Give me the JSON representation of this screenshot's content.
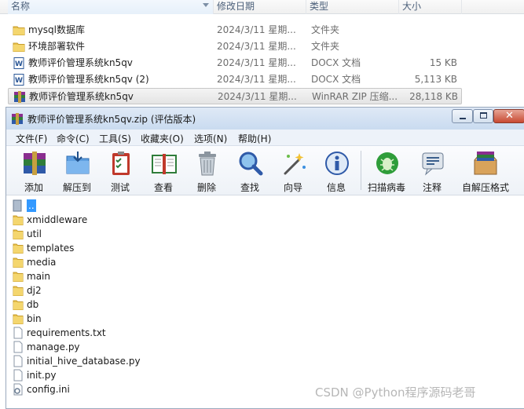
{
  "explorer": {
    "columns": {
      "name": "名称",
      "modified": "修改日期",
      "type": "类型",
      "size": "大小"
    },
    "rows": [
      {
        "name": "mysql数据库",
        "date": "2024/3/11 星期...",
        "type": "文件夹",
        "size": "",
        "icon": "folder-icon"
      },
      {
        "name": "环境部署软件",
        "date": "2024/3/11 星期...",
        "type": "文件夹",
        "size": "",
        "icon": "folder-icon"
      },
      {
        "name": "教师评价管理系统kn5qv",
        "date": "2024/3/11 星期...",
        "type": "DOCX 文档",
        "size": "15 KB",
        "icon": "word-doc-icon"
      },
      {
        "name": "教师评价管理系统kn5qv (2)",
        "date": "2024/3/11 星期...",
        "type": "DOCX 文档",
        "size": "5,113 KB",
        "icon": "word-doc-icon"
      },
      {
        "name": "教师评价管理系统kn5qv",
        "date": "2024/3/11 星期...",
        "type": "WinRAR ZIP 压缩...",
        "size": "28,118 KB",
        "icon": "winrar-archive-icon"
      }
    ]
  },
  "winrar": {
    "title": "教师评价管理系统kn5qv.zip (评估版本)",
    "menu": [
      "文件(F)",
      "命令(C)",
      "工具(S)",
      "收藏夹(O)",
      "选项(N)",
      "帮助(H)"
    ],
    "toolbar": [
      {
        "label": "添加",
        "icon": "add-books-icon"
      },
      {
        "label": "解压到",
        "icon": "extract-folder-icon"
      },
      {
        "label": "测试",
        "icon": "test-clipboard-icon"
      },
      {
        "label": "查看",
        "icon": "view-book-icon"
      },
      {
        "label": "删除",
        "icon": "delete-trash-icon"
      },
      {
        "label": "查找",
        "icon": "find-magnifier-icon"
      },
      {
        "label": "向导",
        "icon": "wizard-wand-icon"
      },
      {
        "label": "信息",
        "icon": "info-icon"
      },
      {
        "label": "扫描病毒",
        "icon": "virus-scan-icon"
      },
      {
        "label": "注释",
        "icon": "comment-icon"
      },
      {
        "label": "自解压格式",
        "icon": "sfx-box-icon"
      }
    ],
    "files": [
      {
        "name": "..",
        "kind": "up"
      },
      {
        "name": "xmiddleware",
        "kind": "folder"
      },
      {
        "name": "util",
        "kind": "folder"
      },
      {
        "name": "templates",
        "kind": "folder"
      },
      {
        "name": "media",
        "kind": "folder"
      },
      {
        "name": "main",
        "kind": "folder"
      },
      {
        "name": "dj2",
        "kind": "folder"
      },
      {
        "name": "db",
        "kind": "folder"
      },
      {
        "name": "bin",
        "kind": "folder"
      },
      {
        "name": "requirements.txt",
        "kind": "file"
      },
      {
        "name": "manage.py",
        "kind": "file"
      },
      {
        "name": "initial_hive_database.py",
        "kind": "file"
      },
      {
        "name": "init.py",
        "kind": "file"
      },
      {
        "name": "config.ini",
        "kind": "config"
      }
    ]
  },
  "watermark": "CSDN @Python程序源码老哥"
}
